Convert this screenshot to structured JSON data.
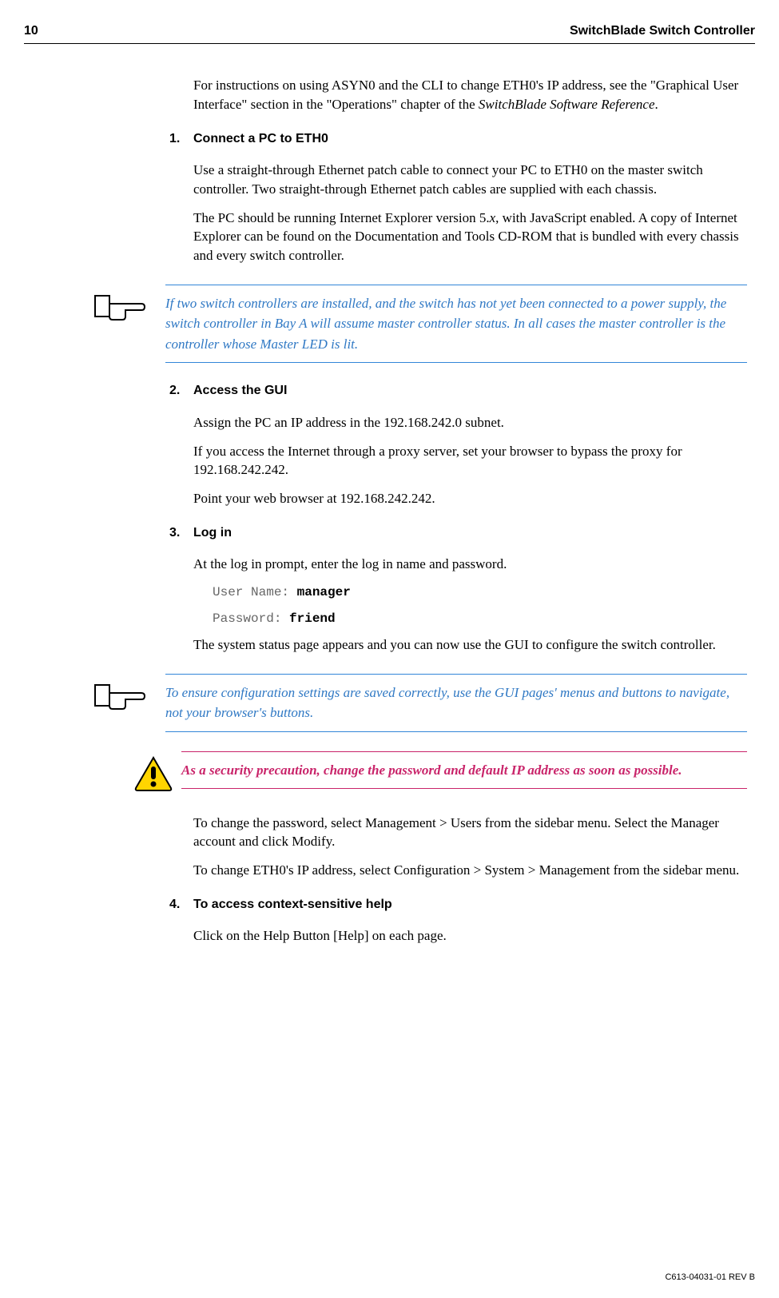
{
  "header": {
    "pageNum": "10",
    "title": "SwitchBlade Switch Controller"
  },
  "intro": {
    "p1a": "For instructions on using ASYN0 and the CLI to change ETH0's IP address, see the \"Graphical User Interface\" section in the \"Operations\" chapter of the ",
    "p1b": "SwitchBlade Software Reference",
    "p1c": "."
  },
  "step1": {
    "num": "1.",
    "title": "Connect a PC to ETH0",
    "p1": "Use a straight-through Ethernet patch cable to connect your PC to ETH0 on the master switch controller. Two straight-through Ethernet patch cables are supplied with each chassis.",
    "p2a": "The PC should be running Internet Explorer version 5.",
    "p2b": "x",
    "p2c": ", with JavaScript enabled. A copy of Internet Explorer can be found on the Documentation and Tools CD-ROM that is bundled with every chassis and every switch controller."
  },
  "note1": "If two switch controllers are installed, and the switch has not yet been connected to a power supply, the switch controller in Bay A will assume master controller status. In all cases the master controller is the controller whose Master LED is lit.",
  "step2": {
    "num": "2.",
    "title": "Access the GUI",
    "p1": "Assign the PC an IP address in the 192.168.242.0 subnet.",
    "p2": "If you access the Internet through a proxy server, set your browser to bypass the proxy for 192.168.242.242.",
    "p3": "Point your web browser at 192.168.242.242."
  },
  "step3": {
    "num": "3.",
    "title": "Log in",
    "p1": "At the log in prompt, enter the log in name and password.",
    "code1a": "User Name: ",
    "code1b": "manager",
    "code2a": "Password: ",
    "code2b": "friend",
    "p2": "The system status page appears and you can now use the GUI to configure the switch controller."
  },
  "note2": "To ensure configuration settings are saved correctly, use the GUI pages' menus and buttons to navigate, not your browser's buttons.",
  "caution": "As a security precaution, change the password and default IP address as soon as possible.",
  "afterCaution": {
    "p1": "To change the password, select Management > Users from the sidebar menu. Select the Manager account and click Modify.",
    "p2": "To change ETH0's IP address, select Configuration > System > Management from the sidebar menu."
  },
  "step4": {
    "num": "4.",
    "title": "To access context-sensitive help",
    "p1": "Click on the Help Button [Help] on each page."
  },
  "footer": "C613-04031-01 REV B"
}
